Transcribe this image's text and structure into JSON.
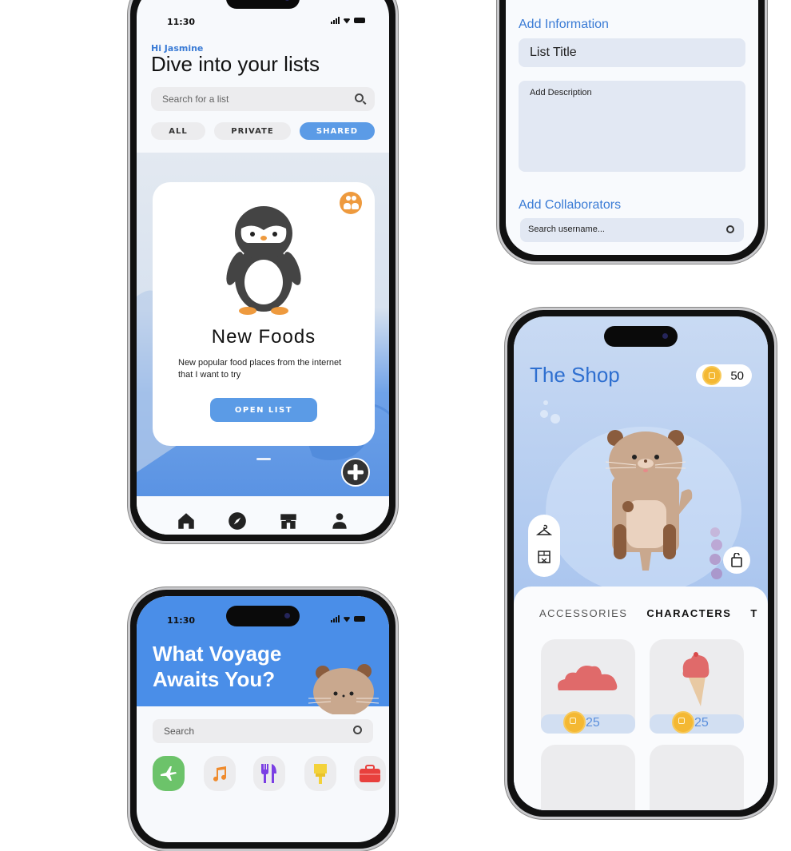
{
  "list_screen": {
    "status_time": "11:30",
    "greeting": "Hi Jasmine",
    "title": "Dive into your lists",
    "search_placeholder": "Search for a list",
    "filters": [
      {
        "label": "ALL",
        "active": false
      },
      {
        "label": "PRIVATE",
        "active": false
      },
      {
        "label": "SHARED",
        "active": true
      }
    ],
    "card": {
      "title": "New Foods",
      "description": "New popular food places from the internet that I want to try",
      "button_label": "OPEN LIST",
      "badge_icon": "group-icon",
      "mascot": "penguin"
    },
    "fab_icon": "plus-icon",
    "nav": [
      {
        "name": "home",
        "icon": "home-icon"
      },
      {
        "name": "explore",
        "icon": "compass-icon"
      },
      {
        "name": "shop",
        "icon": "store-icon"
      },
      {
        "name": "profile",
        "icon": "user-icon"
      }
    ]
  },
  "create_list_screen": {
    "info_heading": "Add Information",
    "title_placeholder": "List Title",
    "description_placeholder": "Add Description",
    "collab_heading": "Add Collaborators",
    "username_placeholder": "Search username..."
  },
  "shop_screen": {
    "title": "The Shop",
    "coin_balance": "50",
    "mascot": "otter",
    "side_icons": [
      "hanger-icon",
      "storefront-icon"
    ],
    "bag_icon": "shopping-bag-icon",
    "tabs": [
      {
        "label": "ACCESSORIES",
        "active": false
      },
      {
        "label": "CHARACTERS",
        "active": true
      },
      {
        "label": "T",
        "active": false
      }
    ],
    "items": [
      {
        "name": "cloud",
        "price": "25",
        "color": "#e06a6a"
      },
      {
        "name": "ice-cream",
        "price": "25",
        "color": "#e06a6a"
      },
      {
        "name": "",
        "price": ""
      },
      {
        "name": "",
        "price": ""
      }
    ]
  },
  "voyage_screen": {
    "status_time": "11:30",
    "title_line1": "What Voyage",
    "title_line2": "Awaits You?",
    "search_placeholder": "Search",
    "categories": [
      {
        "icon": "airplane-icon",
        "color": "#6cc36a"
      },
      {
        "icon": "music-icon",
        "color": "#ef8b2d"
      },
      {
        "icon": "dining-icon",
        "color": "#7b3fe4"
      },
      {
        "icon": "paintbrush-icon",
        "color": "#f3d23a"
      },
      {
        "icon": "briefcase-icon",
        "color": "#e8403d"
      }
    ]
  },
  "colors": {
    "accent_blue": "#5b9be6",
    "heading_blue": "#3a7bd5",
    "badge_orange": "#ee9a3e",
    "coin_gold": "#f4b833"
  }
}
